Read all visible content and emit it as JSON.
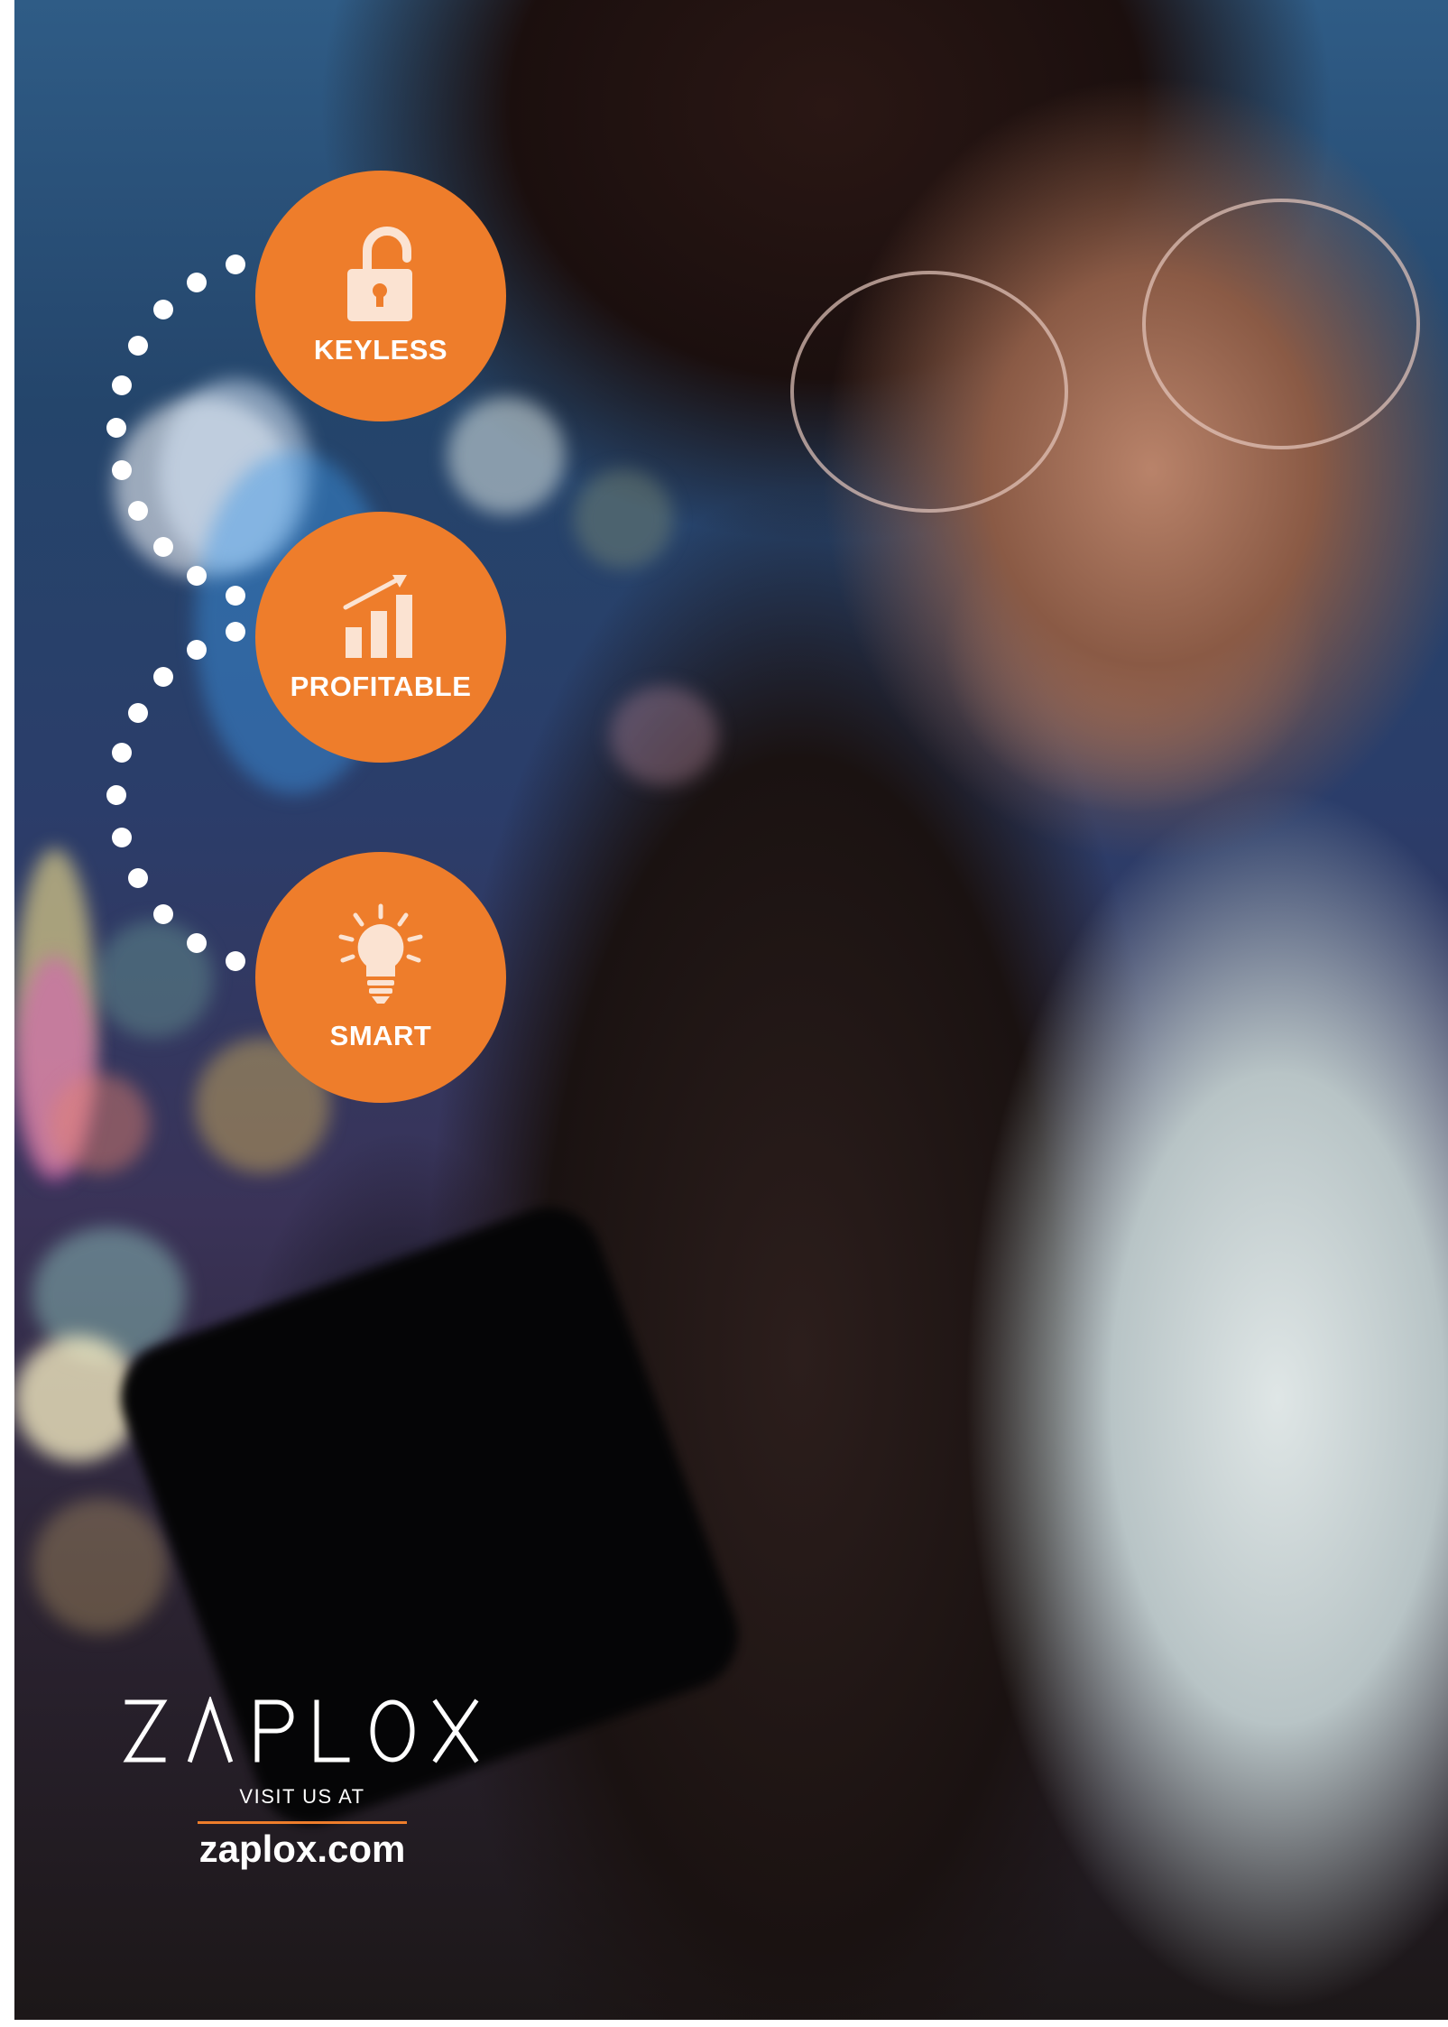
{
  "colors": {
    "accent": "#ee7d2b",
    "text": "#ffffff"
  },
  "features": [
    {
      "label": "KEYLESS",
      "icon": "unlocked-padlock-icon"
    },
    {
      "label": "PROFITABLE",
      "icon": "growth-chart-icon"
    },
    {
      "label": "SMART",
      "icon": "lightbulb-icon"
    }
  ],
  "brand": {
    "logo_text": "ZAPLOX",
    "visit_label": "VISIT US AT",
    "url": "zaplox.com"
  }
}
